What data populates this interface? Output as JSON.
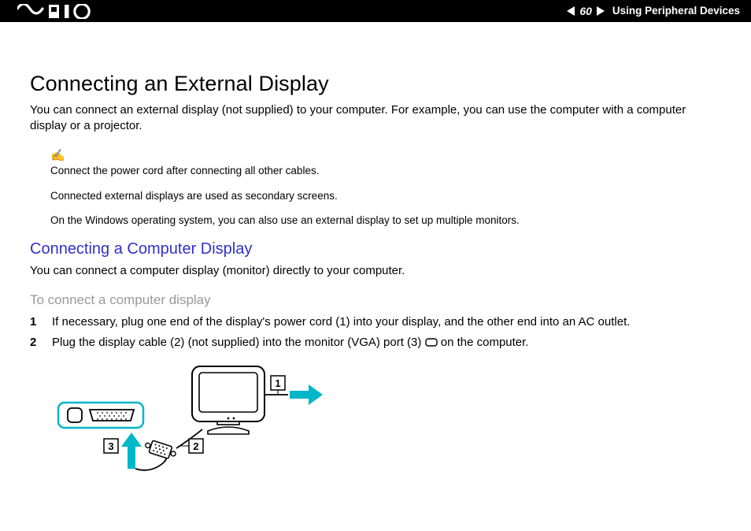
{
  "header": {
    "page_number": "60",
    "section": "Using Peripheral Devices"
  },
  "main": {
    "title": "Connecting an External Display",
    "intro": "You can connect an external display (not supplied) to your computer. For example, you can use the computer with a computer display or a projector.",
    "notes": {
      "n1": "Connect the power cord after connecting all other cables.",
      "n2": "Connected external displays are used as secondary screens.",
      "n3": "On the Windows operating system, you can also use an external display to set up multiple monitors."
    },
    "sub_title": "Connecting a Computer Display",
    "sub_intro": "You can connect a computer display (monitor) directly to your computer.",
    "task_title": "To connect a computer display",
    "steps": {
      "s1_num": "1",
      "s1_txt": "If necessary, plug one end of the display's power cord (1) into your display, and the other end into an AC outlet.",
      "s2_num": "2",
      "s2_txt_a": "Plug the display cable (2) (not supplied) into the monitor (VGA) port (3) ",
      "s2_txt_b": " on the computer."
    }
  },
  "diagram": {
    "c1": "1",
    "c2": "2",
    "c3": "3"
  },
  "colors": {
    "cyan": "#00B6C9"
  }
}
